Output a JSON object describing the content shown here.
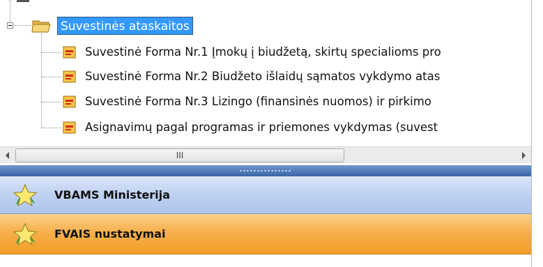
{
  "tree": {
    "root_label": "Suvestinės ataskaitos",
    "items": [
      {
        "label": "Suvestinė Forma Nr.1 Įmokų į biudžetą, skirtų specialioms pro"
      },
      {
        "label": "Suvestinė Forma Nr.2 Biudžeto išlaidų sąmatos vykdymo atas"
      },
      {
        "label": "Suvestinė Forma Nr.3 Lizingo (finansinės nuomos) ir pirkimo"
      },
      {
        "label": "Asignavimų pagal programas ir priemones vykdymas (suvest"
      }
    ]
  },
  "scrollbar": {
    "grip_glyph": "III"
  },
  "nav": {
    "items": [
      {
        "label": "VBAMS Ministerija"
      },
      {
        "label": "FVAIS nustatymai"
      }
    ]
  },
  "colors": {
    "selection": "#3399ff",
    "nav_blue": "#bed1f1",
    "nav_orange": "#f7b04c",
    "splitter": "#3a64a6"
  },
  "icons": {
    "folder": "open-folder-icon",
    "report": "report-icon",
    "nav": "star-icon"
  }
}
